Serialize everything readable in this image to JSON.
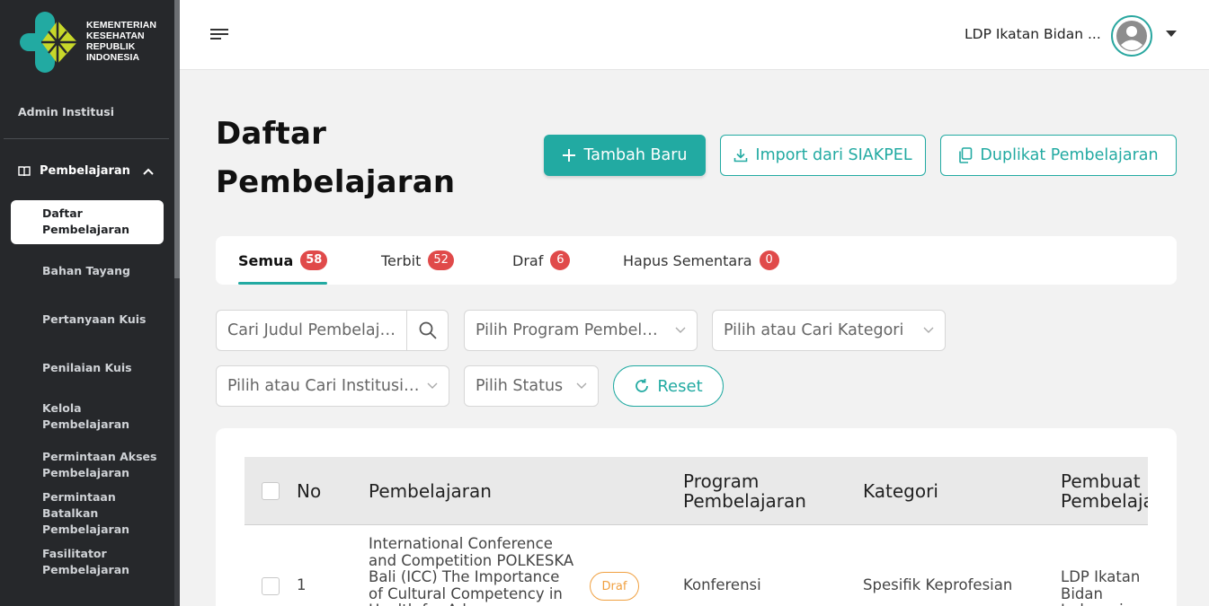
{
  "brand": {
    "logo_text": [
      "KEMENTERIAN",
      "KESEHATAN",
      "REPUBLIK",
      "INDONESIA"
    ],
    "colors": {
      "teal": "#22aaa2",
      "lime": "#c8d82a",
      "sidebar": "#26282b"
    }
  },
  "sidebar": {
    "role": "Admin Institusi",
    "group_label": "Pembelajaran",
    "items": [
      {
        "label": "Daftar Pembelajaran",
        "active": true
      },
      {
        "label": "Bahan Tayang"
      },
      {
        "label": "Pertanyaan Kuis"
      },
      {
        "label": "Penilaian Kuis"
      },
      {
        "label": "Kelola Pembelajaran"
      },
      {
        "label": "Permintaan Akses Pembelajaran"
      },
      {
        "label": "Permintaan Batalkan Pembelajaran"
      },
      {
        "label": "Fasilitator Pembelajaran"
      }
    ]
  },
  "header": {
    "user_name": "LDP Ikatan Bidan ..."
  },
  "page": {
    "title_line1": "Daftar",
    "title_line2": "Pembelajaran",
    "btn_add": "Tambah Baru",
    "btn_import": "Import dari SIAKPEL",
    "btn_duplicate": "Duplikat Pembelajaran"
  },
  "tabs": [
    {
      "label": "Semua",
      "count": "58"
    },
    {
      "label": "Terbit",
      "count": "52"
    },
    {
      "label": "Draf",
      "count": "6"
    },
    {
      "label": "Hapus Sementara",
      "count": "0"
    }
  ],
  "filters": {
    "search_placeholder": "Cari Judul Pembelajaran",
    "program_placeholder": "Pilih Program Pembelajaran",
    "category_placeholder": "Pilih atau Cari Kategori",
    "institution_placeholder": "Pilih atau Cari Institusi Pembuat",
    "status_placeholder": "Pilih Status",
    "reset_label": "Reset"
  },
  "table": {
    "columns": [
      "No",
      "Pembelajaran",
      "Program Pembelajaran",
      "Kategori",
      "Pembuat Pembelajaran"
    ],
    "rows": [
      {
        "no": "1",
        "title": "International Conference and Competition POLKESKA Bali (ICC) The Importance of Cultural Competency in Health for Advance",
        "status": "Draf",
        "program": "Konferensi",
        "category": "Spesifik Keprofesian",
        "creator": "LDP Ikatan Bidan Indonesia"
      }
    ]
  }
}
